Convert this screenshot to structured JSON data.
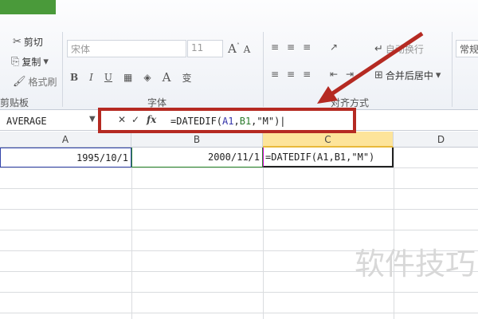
{
  "ribbon": {
    "clipboard": {
      "cut": "剪切",
      "copy": "复制",
      "format_painter": "格式刷",
      "group_label": "剪贴板"
    },
    "font": {
      "font_name": "宋体",
      "font_size": "11",
      "bold": "B",
      "italic": "I",
      "underline": "U",
      "font_color": "A",
      "group_label": "字体"
    },
    "alignment": {
      "wrap_text": "自动换行",
      "merge_center": "合并后居中",
      "group_label": "对齐方式"
    },
    "number": {
      "format": "常规"
    }
  },
  "formula_bar": {
    "name_box": "AVERAGE",
    "cancel": "✕",
    "enter": "✓",
    "fx": "fx",
    "formula": "=DATEDIF(A1,B1,\"M\")",
    "formula_parts": [
      "=DATEDIF(",
      "A1",
      ",",
      "B1",
      ",\"M\")"
    ]
  },
  "sheet": {
    "columns": [
      "A",
      "B",
      "C",
      "D"
    ],
    "row1": {
      "A": "1995/10/1",
      "B": "2000/11/1",
      "C": "=DATEDIF(A1,B1,\"M\")"
    }
  },
  "watermark": "软件技巧",
  "colors": {
    "highlight_box": "#b52a22",
    "arrow": "#b52a22",
    "ref_a1": "#3333aa",
    "ref_b1": "#2a7a2a"
  }
}
